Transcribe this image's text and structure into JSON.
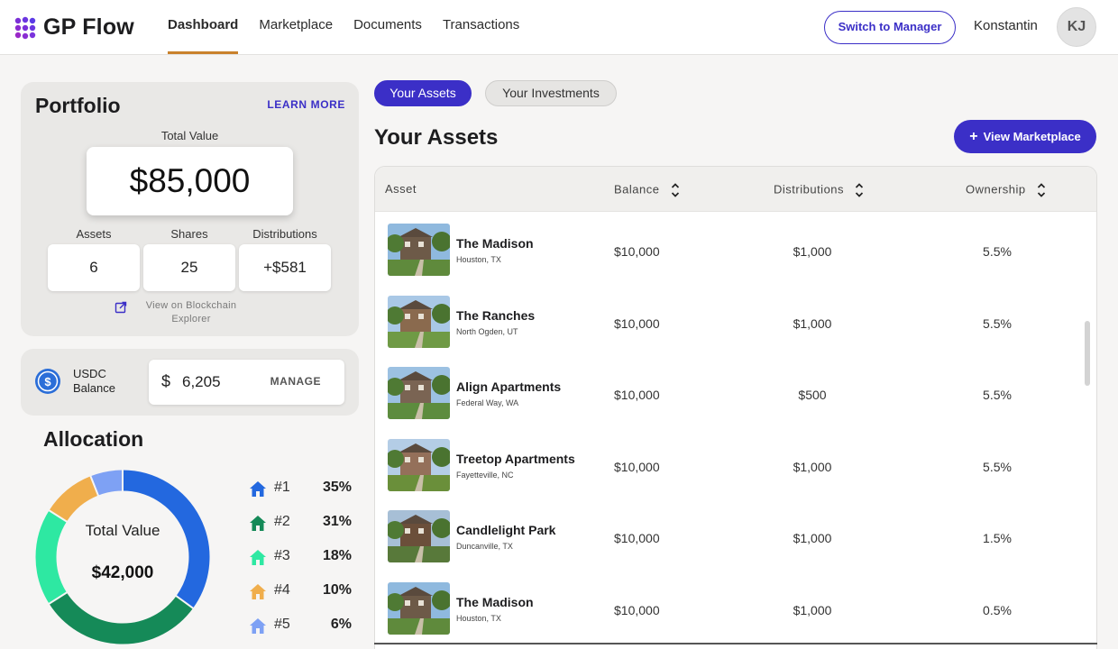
{
  "app": {
    "name": "GP Flow"
  },
  "nav": [
    {
      "label": "Dashboard",
      "active": true
    },
    {
      "label": "Marketplace",
      "active": false
    },
    {
      "label": "Documents",
      "active": false
    },
    {
      "label": "Transactions",
      "active": false
    }
  ],
  "header": {
    "switch_label": "Switch to Manager",
    "user_name": "Konstantin",
    "avatar_initials": "KJ"
  },
  "portfolio": {
    "title": "Portfolio",
    "learn_more": "LEARN MORE",
    "total_label": "Total Value",
    "total_value": "$85,000",
    "stats": [
      {
        "label": "Assets",
        "value": "6"
      },
      {
        "label": "Shares",
        "value": "25"
      },
      {
        "label": "Distributions",
        "value": "+$581"
      }
    ],
    "explorer_label": "View on Blockchain Explorer"
  },
  "usdc": {
    "label": "USDC Balance",
    "currency_symbol": "$",
    "value": "6,205",
    "manage_label": "MANAGE"
  },
  "allocation": {
    "title": "Allocation",
    "center_label": "Total Value",
    "center_value": "$42,000",
    "items": [
      {
        "rank": "#1",
        "pct": "35%",
        "value": 35,
        "color": "#2368df"
      },
      {
        "rank": "#2",
        "pct": "31%",
        "value": 31,
        "color": "#158a58"
      },
      {
        "rank": "#3",
        "pct": "18%",
        "value": 18,
        "color": "#2ee8a2"
      },
      {
        "rank": "#4",
        "pct": "10%",
        "value": 10,
        "color": "#f0ae4c"
      },
      {
        "rank": "#5",
        "pct": "6%",
        "value": 6,
        "color": "#7ea1f4"
      }
    ]
  },
  "tabs": [
    {
      "label": "Your Assets",
      "active": true
    },
    {
      "label": "Your Investments",
      "active": false
    }
  ],
  "assets_section": {
    "title": "Your Assets",
    "view_marketplace": "View Marketplace",
    "plus": "+"
  },
  "table": {
    "columns": [
      "Asset",
      "Balance",
      "Distributions",
      "Ownership"
    ],
    "rows": [
      {
        "name": "The Madison",
        "location": "Houston, TX",
        "balance": "$10,000",
        "distributions": "$1,000",
        "ownership": "5.5%"
      },
      {
        "name": "The Ranches",
        "location": "North Ogden, UT",
        "balance": "$10,000",
        "distributions": "$1,000",
        "ownership": "5.5%"
      },
      {
        "name": "Align Apartments",
        "location": "Federal Way, WA",
        "balance": "$10,000",
        "distributions": "$500",
        "ownership": "5.5%"
      },
      {
        "name": "Treetop Apartments",
        "location": "Fayetteville, NC",
        "balance": "$10,000",
        "distributions": "$1,000",
        "ownership": "5.5%"
      },
      {
        "name": "Candlelight Park",
        "location": "Duncanville, TX",
        "balance": "$10,000",
        "distributions": "$1,000",
        "ownership": "1.5%"
      },
      {
        "name": "The Madison",
        "location": "Houston, TX",
        "balance": "$10,000",
        "distributions": "$1,000",
        "ownership": "0.5%"
      }
    ]
  },
  "colors": {
    "accent": "#3b2fc7",
    "nav_underline": "#c9812b",
    "card_bg": "#e9e8e6"
  }
}
